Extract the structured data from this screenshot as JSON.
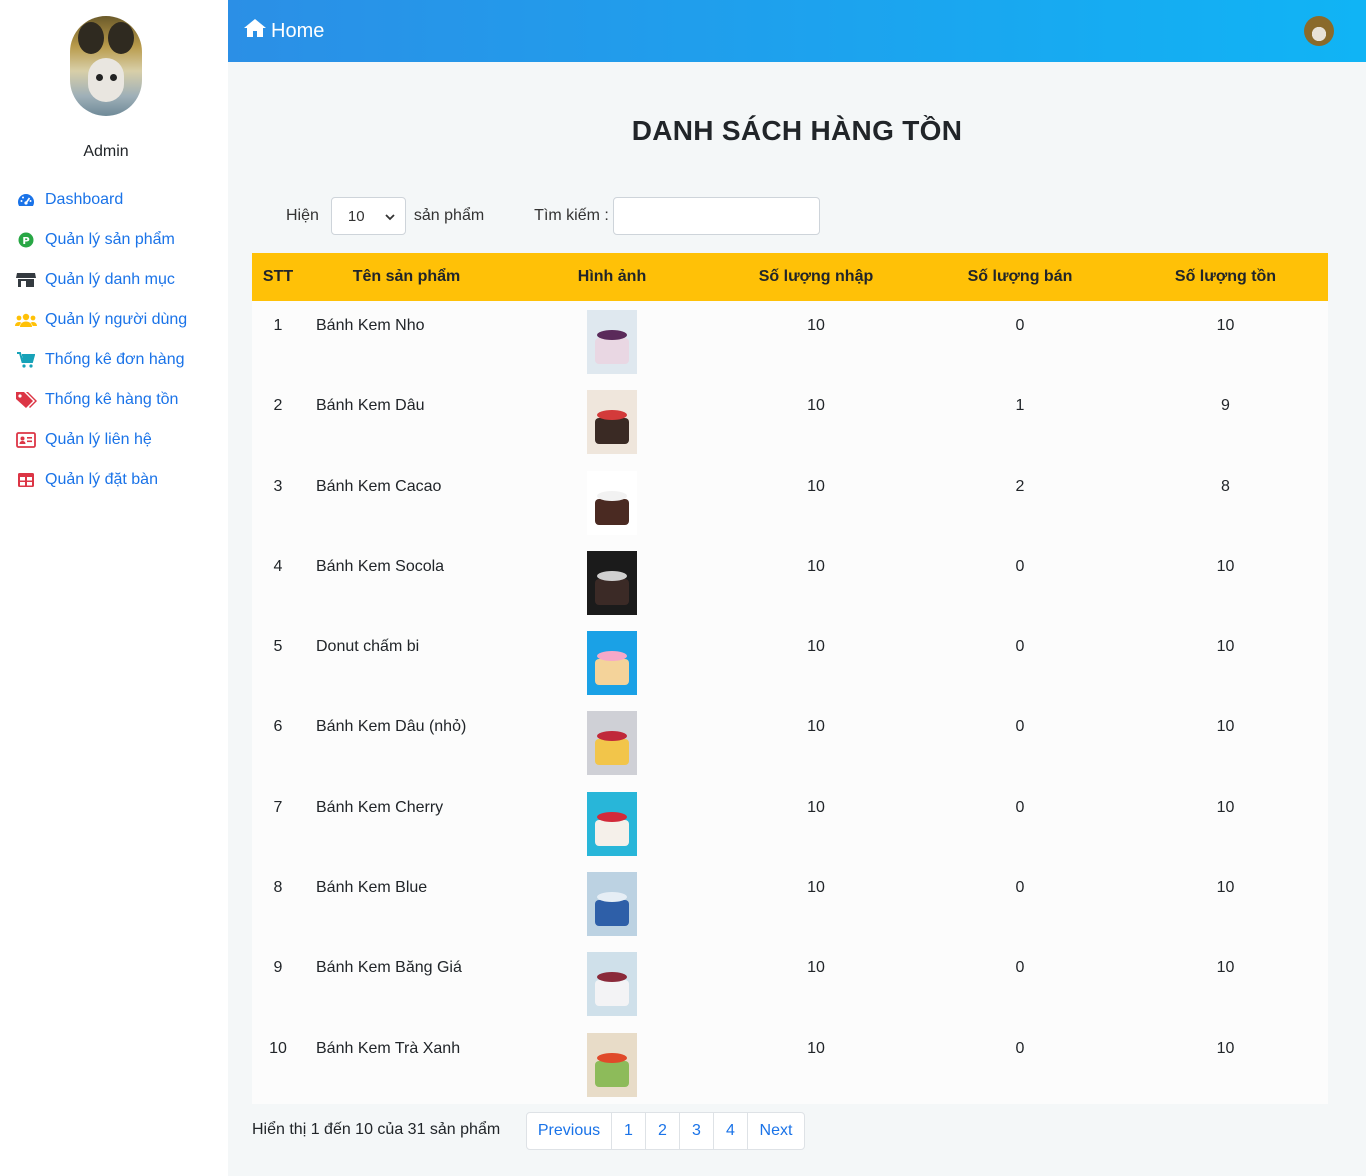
{
  "sidebar": {
    "admin_name": "Admin",
    "items": [
      {
        "label": "Dashboard",
        "icon": "gauge-icon",
        "color": "#1a73e8"
      },
      {
        "label": "Quản lý sản phẩm",
        "icon": "product-p-icon",
        "color": "#28a745"
      },
      {
        "label": "Quản lý danh mục",
        "icon": "store-icon",
        "color": "#343a40"
      },
      {
        "label": "Quản lý người dùng",
        "icon": "users-icon",
        "color": "#ffc107"
      },
      {
        "label": "Thống kê đơn hàng",
        "icon": "cart-icon",
        "color": "#17a2b8"
      },
      {
        "label": "Thống kê hàng tồn",
        "icon": "tags-icon",
        "color": "#dc3545"
      },
      {
        "label": "Quản lý liên hệ",
        "icon": "contact-card-icon",
        "color": "#dc3545"
      },
      {
        "label": "Quản lý đặt bàn",
        "icon": "table-grid-icon",
        "color": "#dc3545"
      }
    ]
  },
  "topbar": {
    "home_label": "Home"
  },
  "page": {
    "title": "DANH SÁCH HÀNG TỒN"
  },
  "controls": {
    "show_label": "Hiện",
    "page_size": "10",
    "unit_label": "sản phẩm",
    "search_label": "Tìm kiếm :",
    "search_value": ""
  },
  "table": {
    "headers": [
      "STT",
      "Tên sản phẩm",
      "Hình ảnh",
      "Số lượng nhập",
      "Số lượng bán",
      "Số lượng tồn"
    ],
    "rows": [
      {
        "stt": "1",
        "name": "Bánh Kem Nho",
        "imported": "10",
        "sold": "0",
        "stock": "10",
        "bg": "#dfe8ef",
        "cake": "#e9d7e3",
        "top": "#5a2a5a"
      },
      {
        "stt": "2",
        "name": "Bánh Kem Dâu",
        "imported": "10",
        "sold": "1",
        "stock": "9",
        "bg": "#efe6dc",
        "cake": "#3a2a24",
        "top": "#d33a3a"
      },
      {
        "stt": "3",
        "name": "Bánh Kem Cacao",
        "imported": "10",
        "sold": "2",
        "stock": "8",
        "bg": "#ffffff",
        "cake": "#4a2a22",
        "top": "#f2f2f2"
      },
      {
        "stt": "4",
        "name": "Bánh Kem Socola",
        "imported": "10",
        "sold": "0",
        "stock": "10",
        "bg": "#1b1b1b",
        "cake": "#3b2a26",
        "top": "#cfcfcf"
      },
      {
        "stt": "5",
        "name": "Donut chấm bi",
        "imported": "10",
        "sold": "0",
        "stock": "10",
        "bg": "#1aa1e6",
        "cake": "#f4d39a",
        "top": "#f6a8c8"
      },
      {
        "stt": "6",
        "name": "Bánh Kem Dâu (nhỏ)",
        "imported": "10",
        "sold": "0",
        "stock": "10",
        "bg": "#cfd0d6",
        "cake": "#f2c54a",
        "top": "#c0283a"
      },
      {
        "stt": "7",
        "name": "Bánh Kem Cherry",
        "imported": "10",
        "sold": "0",
        "stock": "10",
        "bg": "#28b6d9",
        "cake": "#f5f0ea",
        "top": "#d22a3a"
      },
      {
        "stt": "8",
        "name": "Bánh Kem Blue",
        "imported": "10",
        "sold": "0",
        "stock": "10",
        "bg": "#bcd2e2",
        "cake": "#2e5fa8",
        "top": "#e6eef5"
      },
      {
        "stt": "9",
        "name": "Bánh Kem Băng Giá",
        "imported": "10",
        "sold": "0",
        "stock": "10",
        "bg": "#cfe0ea",
        "cake": "#f3f3f5",
        "top": "#8a2a3a"
      },
      {
        "stt": "10",
        "name": "Bánh Kem Trà Xanh",
        "imported": "10",
        "sold": "0",
        "stock": "10",
        "bg": "#e8dcc8",
        "cake": "#8dbb5a",
        "top": "#e04a2a"
      }
    ]
  },
  "footer": {
    "info": "Hiển thị 1 đến 10 của 31 sản phẩm",
    "pagination": [
      {
        "label": "Previous"
      },
      {
        "label": "1"
      },
      {
        "label": "2"
      },
      {
        "label": "3"
      },
      {
        "label": "4"
      },
      {
        "label": "Next"
      }
    ]
  }
}
